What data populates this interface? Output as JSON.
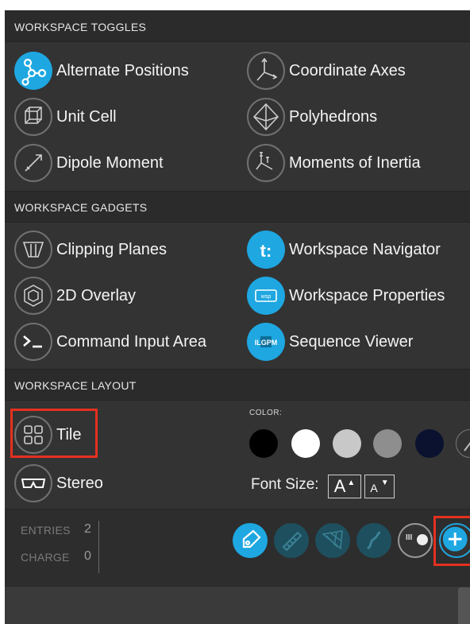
{
  "sections": {
    "toggles": "WORKSPACE TOGGLES",
    "gadgets": "WORKSPACE GADGETS",
    "layout": "WORKSPACE LAYOUT"
  },
  "toggles": {
    "alternate_positions": "Alternate Positions",
    "coordinate_axes": "Coordinate Axes",
    "unit_cell": "Unit Cell",
    "polyhedrons": "Polyhedrons",
    "dipole_moment": "Dipole Moment",
    "moments_of_inertia": "Moments of Inertia"
  },
  "gadgets": {
    "clipping_planes": "Clipping Planes",
    "workspace_navigator": "Workspace Navigator",
    "overlay_2d": "2D Overlay",
    "workspace_properties": "Workspace Properties",
    "command_input_area": "Command Input Area",
    "sequence_viewer": "Sequence Viewer"
  },
  "layout": {
    "tile": "Tile",
    "stereo": "Stereo",
    "color_label": "COLOR:",
    "font_size_label": "Font Size:",
    "font_increase": "A",
    "font_decrease": "A",
    "swatches": [
      "#000000",
      "#ffffff",
      "#c8c8c8",
      "#8e8e8e",
      "#0a1230",
      "#333333"
    ]
  },
  "stats": {
    "entries_label": "ENTRIES",
    "entries_value": "2",
    "charge_label": "CHARGE",
    "charge_value": "0"
  },
  "icons": {
    "navigator_glyph": "t:",
    "properties_glyph": "wsp",
    "sequence_glyph": "ILGPM",
    "toggle_glyph": "III"
  },
  "colors": {
    "accent": "#1ea7e1",
    "highlight": "#e53020",
    "panel": "#333333"
  }
}
